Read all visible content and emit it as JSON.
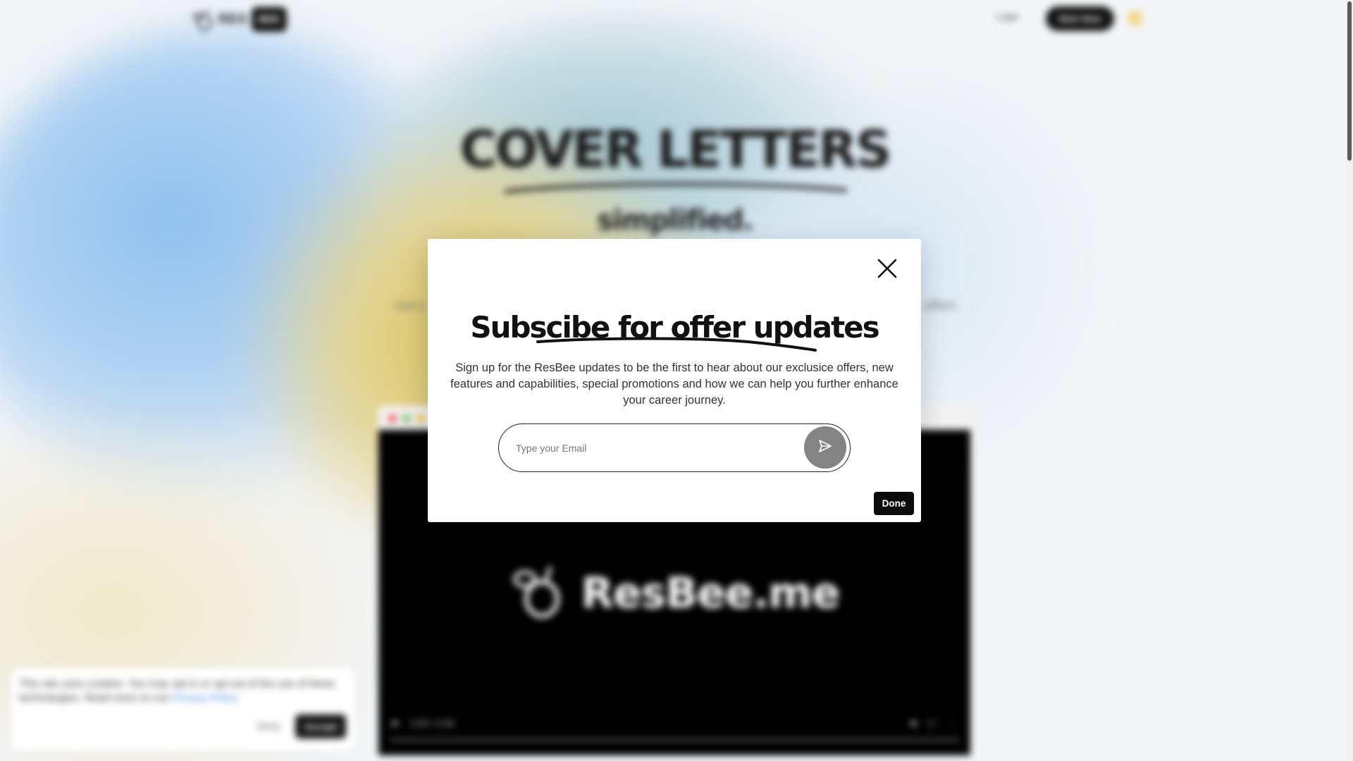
{
  "nav": {
    "logo_left": "RES",
    "logo_right": "BEE",
    "login_label": "Login",
    "start_label": "Start Now"
  },
  "hero": {
    "title": "COVER LETTERS",
    "subtitle": "simplified.",
    "desc_left": "Get y",
    "desc_right": "effort."
  },
  "video": {
    "brand": "ResBee.me",
    "time": "0:00 / 0:36"
  },
  "cookie": {
    "text": "This site uses cookies. You may opt in or opt out of the use of these technologies. Read more on our",
    "link": "Privacy Policy",
    "deny_label": "Deny",
    "accept_label": "Accept"
  },
  "modal": {
    "title": "Subscibe for offer updates",
    "text": "Sign up for the ResBee updates to be the first to hear about our exclusice offers, new features and capabilities, special promotions and how we can help you further enhance your career journey.",
    "email_placeholder": "Type your Email",
    "done_label": "Done"
  },
  "icons": {
    "close": "close-icon",
    "send": "send-icon",
    "bee": "bee-icon"
  },
  "colors": {
    "accent_dark": "#0b0b0b",
    "send_button": "#838383",
    "cookie_link": "#3b87e0"
  }
}
